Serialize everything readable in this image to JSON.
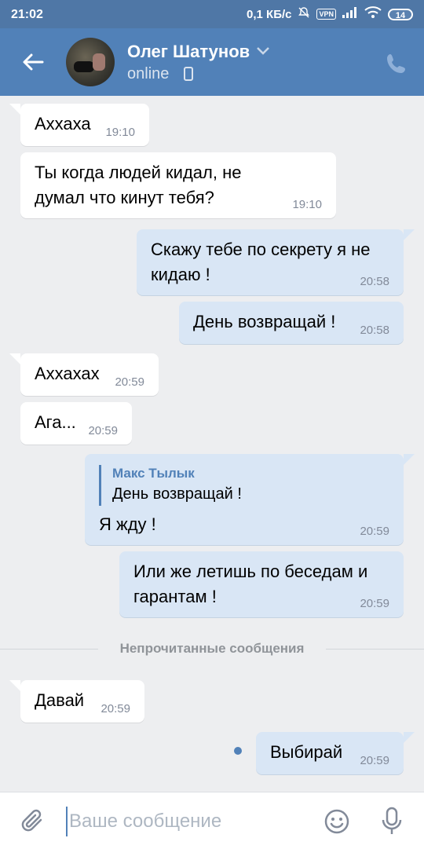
{
  "status_bar": {
    "time": "21:02",
    "network_speed": "0,1 КБ/с",
    "vpn": "VPN",
    "battery": "14",
    "icons": [
      "bell-off-icon",
      "vpn-icon",
      "signal-icon",
      "wifi-icon",
      "battery-icon"
    ]
  },
  "header": {
    "contact_name": "Олег Шатунов",
    "status": "online",
    "icons": [
      "back-arrow-icon",
      "chevron-down-icon",
      "phone-device-icon",
      "call-icon"
    ],
    "color": "#5181b8"
  },
  "messages": [
    {
      "direction": "in",
      "text": "Аххаха",
      "time": "19:10"
    },
    {
      "direction": "in",
      "text": "Ты когда людей кидал, не думал что кинут тебя?",
      "time": "19:10"
    },
    {
      "direction": "out",
      "text": "Скажу тебе по секрету я не кидаю !",
      "time": "20:58"
    },
    {
      "direction": "out",
      "text": "День возвращай !",
      "time": "20:58"
    },
    {
      "direction": "in",
      "text": "Аххахах",
      "time": "20:59"
    },
    {
      "direction": "in",
      "text": "Ага...",
      "time": "20:59"
    },
    {
      "direction": "out",
      "reply_author": "Макс Тылык",
      "reply_text": "День возвращай !",
      "text": "Я жду !",
      "time": "20:59"
    },
    {
      "direction": "out",
      "text": "Или же летишь по беседам и гарантам !",
      "time": "20:59"
    },
    {
      "direction": "in",
      "text": "Давай",
      "time": "20:59"
    },
    {
      "direction": "out",
      "text": "Выбирай",
      "time": "20:59"
    }
  ],
  "unread_divider": "Непрочитанные сообщения",
  "composer": {
    "placeholder": "Ваше сообщение",
    "icons": [
      "paperclip-icon",
      "emoji-icon",
      "microphone-icon"
    ]
  },
  "colors": {
    "incoming_bubble": "#ffffff",
    "outgoing_bubble": "#d9e6f5",
    "background": "#edeef0",
    "accent": "#5181b8"
  }
}
